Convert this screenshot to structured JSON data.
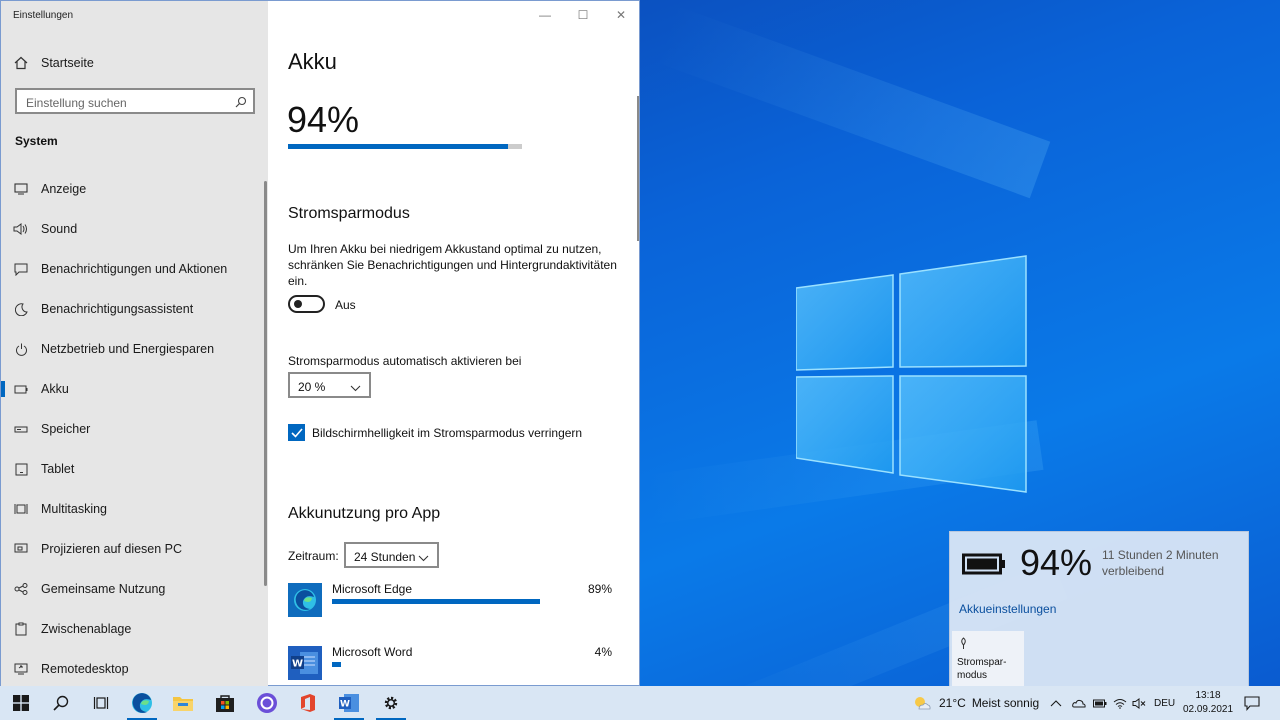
{
  "window": {
    "title": "Einstellungen",
    "minimize_glyph": "—",
    "maximize_glyph": "☐",
    "close_glyph": "✕"
  },
  "sidebar": {
    "home_label": "Startseite",
    "search_placeholder": "Einstellung suchen",
    "section": "System",
    "items": [
      {
        "label": "Anzeige",
        "icon": "display-icon"
      },
      {
        "label": "Sound",
        "icon": "sound-icon"
      },
      {
        "label": "Benachrichtigungen und Aktionen",
        "icon": "notification-icon"
      },
      {
        "label": "Benachrichtigungsassistent",
        "icon": "moon-icon"
      },
      {
        "label": "Netzbetrieb und Energiesparen",
        "icon": "power-icon"
      },
      {
        "label": "Akku",
        "icon": "battery-icon",
        "active": true
      },
      {
        "label": "Speicher",
        "icon": "storage-icon"
      },
      {
        "label": "Tablet",
        "icon": "tablet-icon"
      },
      {
        "label": "Multitasking",
        "icon": "multitasking-icon"
      },
      {
        "label": "Projizieren auf diesen PC",
        "icon": "project-icon"
      },
      {
        "label": "Gemeinsame Nutzung",
        "icon": "share-icon"
      },
      {
        "label": "Zwischenablage",
        "icon": "clipboard-icon"
      },
      {
        "label": "Remotedesktop",
        "icon": "remote-icon"
      }
    ]
  },
  "main": {
    "title": "Akku",
    "battery_percent_label": "94%",
    "battery_level": 0.94,
    "saver": {
      "heading": "Stromsparmodus",
      "description": "Um Ihren Akku bei niedrigem Akkustand optimal zu nutzen, schränken Sie Benachrichtigungen und Hintergrundaktivitäten ein.",
      "toggle_state": "Aus",
      "auto_label": "Stromsparmodus automatisch aktivieren bei",
      "auto_value": "20 %",
      "brightness_label": "Bildschirmhelligkeit im Stromsparmodus verringern",
      "brightness_checked": true
    },
    "usage": {
      "heading": "Akkunutzung pro App",
      "period_label": "Zeitraum:",
      "period_value": "24 Stunden",
      "apps": [
        {
          "name": "Microsoft Edge",
          "percent_label": "89%",
          "share": 0.89,
          "icon": "edge-icon"
        },
        {
          "name": "Microsoft Word",
          "percent_label": "4%",
          "share": 0.04,
          "icon": "word-icon"
        }
      ]
    }
  },
  "flyout": {
    "percent": "94%",
    "remaining_line1": "11 Stunden 2 Minuten",
    "remaining_line2": "verbleibend",
    "settings_link": "Akkueinstellungen",
    "saver_tile_line1": "Stromspar-",
    "saver_tile_line2": "modus"
  },
  "taskbar": {
    "weather_temp": "21°C",
    "weather_text": "Meist sonnig",
    "language": "DEU",
    "time": "13:18",
    "date": "02.09.2021"
  },
  "colors": {
    "accent": "#0067c0",
    "desktop": "#0a5bd0",
    "sidebar": "#e6e6e6",
    "taskbar": "#d9e6f4"
  }
}
